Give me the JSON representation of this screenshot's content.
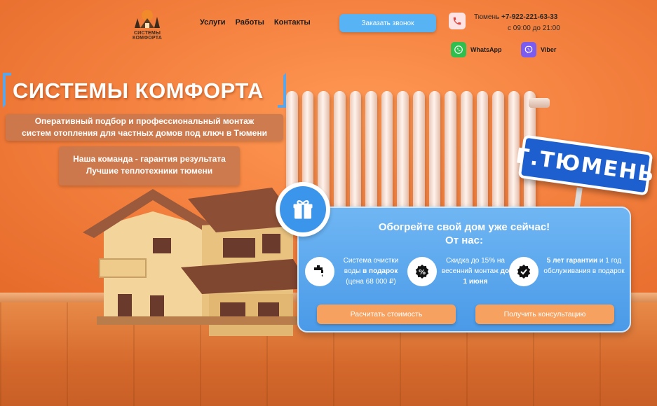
{
  "header": {
    "logo_text": "СИСТЕМЫ КОМФОРТА",
    "nav": [
      "Услуги",
      "Работы",
      "Контакты"
    ],
    "callback_button": "Заказать звонок",
    "city_label": "Тюмень",
    "phone": "+7-922-221-63-33",
    "hours": "с 09:00 до 21:00",
    "messengers": [
      {
        "label": "WhatsApp",
        "icon": "whatsapp-icon",
        "color": "#2fbf4f"
      },
      {
        "label": "Viber",
        "icon": "viber-icon",
        "color": "#7b5cf0"
      }
    ]
  },
  "hero": {
    "title": "СИСТЕМЫ КОМФОРТА",
    "subtitle_line1": "Оперативный подбор и профессиональный монтаж",
    "subtitle_line2": "систем отопления для частных домов под ключ в Тюмени",
    "team_line1": "Наша команда - гарантия результата",
    "team_line2": "Лучшие теплотехники тюмени",
    "city_sign": "Г.ТЮМЕНЬ"
  },
  "offer": {
    "title_line1": "Обогрейте свой дом уже сейчас!",
    "title_line2": "От нас:",
    "features": [
      {
        "icon": "faucet-icon",
        "pre": "Система очистки воды ",
        "bold": "в подарок",
        "post": " (цена 68 000 ₽)"
      },
      {
        "icon": "percent-icon",
        "pre": "Скидка до 15% на весенний монтаж ",
        "bold": "до 1 июня",
        "post": ""
      },
      {
        "icon": "check-badge-icon",
        "pre": "",
        "bold": "5 лет гарантии",
        "post": " и 1 год обслуживания в подарок"
      }
    ],
    "btn_calc": "Расчитать стоимость",
    "btn_consult": "Получить консультацию"
  },
  "colors": {
    "accent_blue": "#58b3f5",
    "card_blue": "#4a9ae8",
    "button_orange": "#f6a15f",
    "background_orange": "#f07a3c"
  }
}
